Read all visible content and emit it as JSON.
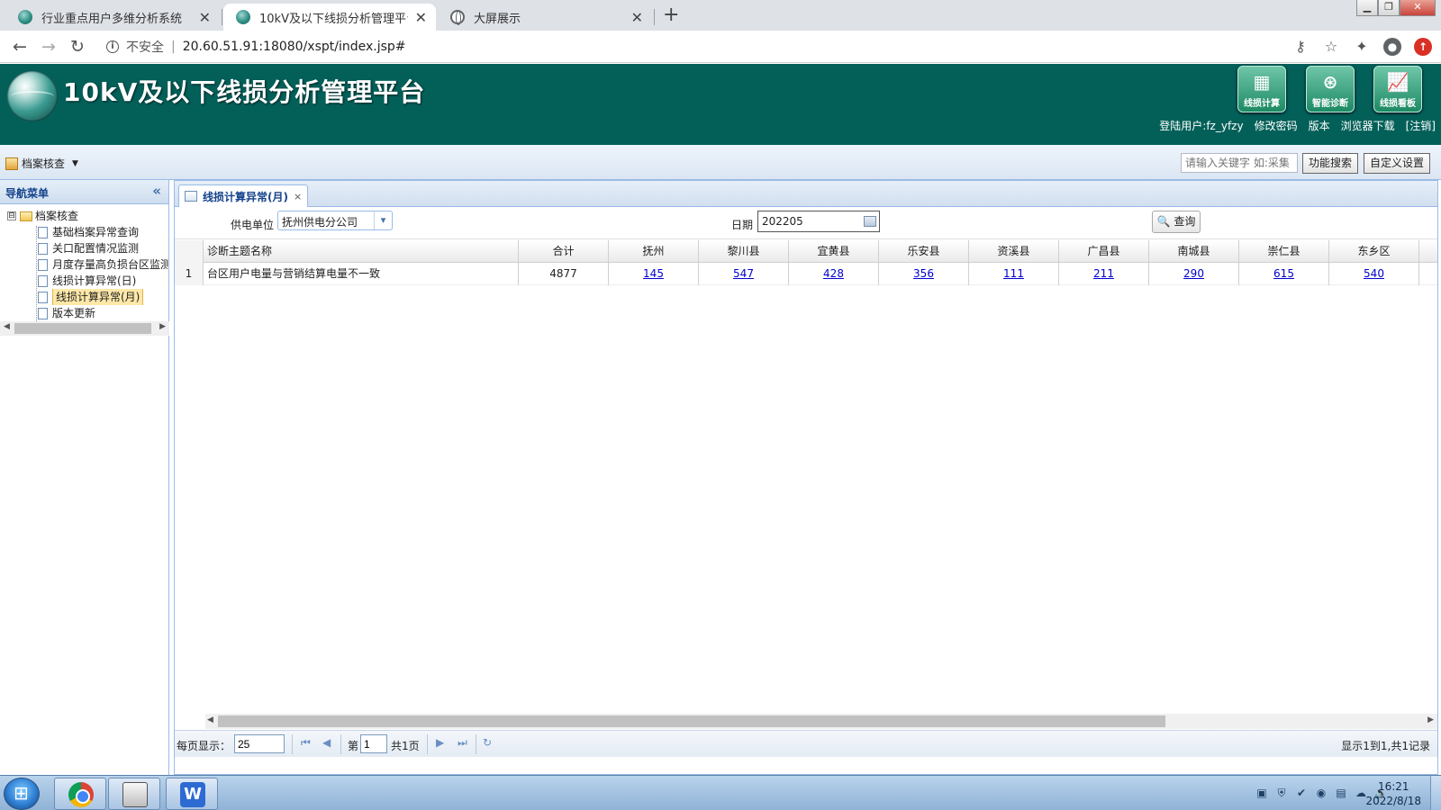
{
  "browser": {
    "tabs": [
      {
        "title": "行业重点用户多维分析系统",
        "active": false
      },
      {
        "title": "10kV及以下线损分析管理平台",
        "active": true
      },
      {
        "title": "大屏展示",
        "active": false
      }
    ],
    "security_label": "不安全",
    "url": "20.60.51.91:18080/xspt/index.jsp#"
  },
  "header": {
    "title": "10kV及以下线损分析管理平台",
    "quick_buttons": [
      {
        "label": "线损计算",
        "icon": "calculator-icon"
      },
      {
        "label": "智能诊断",
        "icon": "diagnosis-icon"
      },
      {
        "label": "线损看板",
        "icon": "chart-board-icon"
      }
    ],
    "user_label": "登陆用户:fz_yfzy",
    "links": [
      "修改密码",
      "版本",
      "浏览器下载",
      "[注销]"
    ]
  },
  "toolbar": {
    "menu_label": "档案核查",
    "search_placeholder": "请输入关键字 如:采集",
    "func_search_label": "功能搜索",
    "custom_settings_label": "自定义设置"
  },
  "nav": {
    "title": "导航菜单",
    "root": {
      "label": "档案核查",
      "expander": "⊟"
    },
    "items": [
      {
        "label": "基础档案异常查询",
        "selected": false
      },
      {
        "label": "关口配置情况监测",
        "selected": false
      },
      {
        "label": "月度存量高负损台区监测",
        "selected": false
      },
      {
        "label": "线损计算异常(日)",
        "selected": false
      },
      {
        "label": "线损计算异常(月)",
        "selected": true
      },
      {
        "label": "版本更新",
        "selected": false
      }
    ]
  },
  "panel": {
    "tab_title": "线损计算异常(月)",
    "tab_close": "×",
    "filter": {
      "unit_label": "供电单位",
      "unit_value": "抚州供电分公司",
      "date_label": "日期",
      "date_value": "202205",
      "query_label": "查询"
    },
    "grid": {
      "headers": [
        "诊断主题名称",
        "合计",
        "抚州",
        "黎川县",
        "宜黄县",
        "乐安县",
        "资溪县",
        "广昌县",
        "南城县",
        "崇仁县",
        "东乡区"
      ],
      "rows": [
        {
          "rn": "1",
          "name": "台区用户电量与营销结算电量不一致",
          "total": "4877",
          "values": [
            "145",
            "547",
            "428",
            "356",
            "111",
            "211",
            "290",
            "615",
            "540"
          ]
        }
      ]
    },
    "pager": {
      "per_page_label": "每页显示：",
      "per_page_value": "25",
      "page_prefix": "第",
      "page_value": "1",
      "page_total": "共1页",
      "summary": "显示1到1,共1记录"
    }
  },
  "taskbar": {
    "time": "16:21",
    "date": "2022/8/18"
  }
}
